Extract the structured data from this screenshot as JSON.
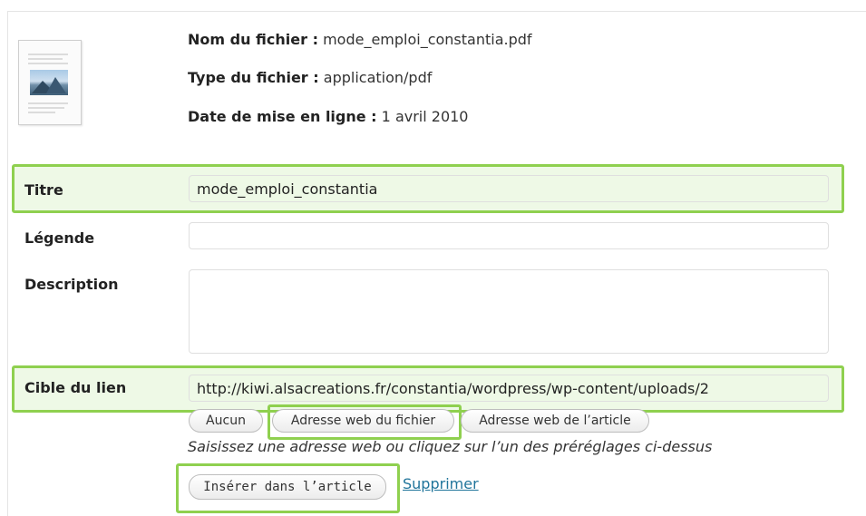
{
  "file_info": {
    "name_label": "Nom du fichier :",
    "name_value": "mode_emploi_constantia.pdf",
    "type_label": "Type du fichier :",
    "type_value": "application/pdf",
    "date_label": "Date de mise en ligne :",
    "date_value": "1 avril 2010",
    "thumbnail_icon": "pdf-document-thumbnail-icon"
  },
  "form": {
    "title_label": "Titre",
    "title_value": "mode_emploi_constantia",
    "caption_label": "Légende",
    "caption_value": "",
    "description_label": "Description",
    "description_value": "",
    "link_label": "Cible du lien",
    "link_value": "http://kiwi.alsacreations.fr/constantia/wordpress/wp-content/uploads/2",
    "link_buttons": [
      "Aucun",
      "Adresse web du fichier",
      "Adresse web de l’article"
    ],
    "link_hint": "Saisissez une adresse web ou cliquez sur l’un des préréglages ci-dessus",
    "insert_button": "Insérer dans l’article",
    "delete_link": "Supprimer"
  },
  "colors": {
    "highlight_border": "#8fd04f",
    "highlight_fill": "#eef9e6",
    "link": "#21759b"
  }
}
